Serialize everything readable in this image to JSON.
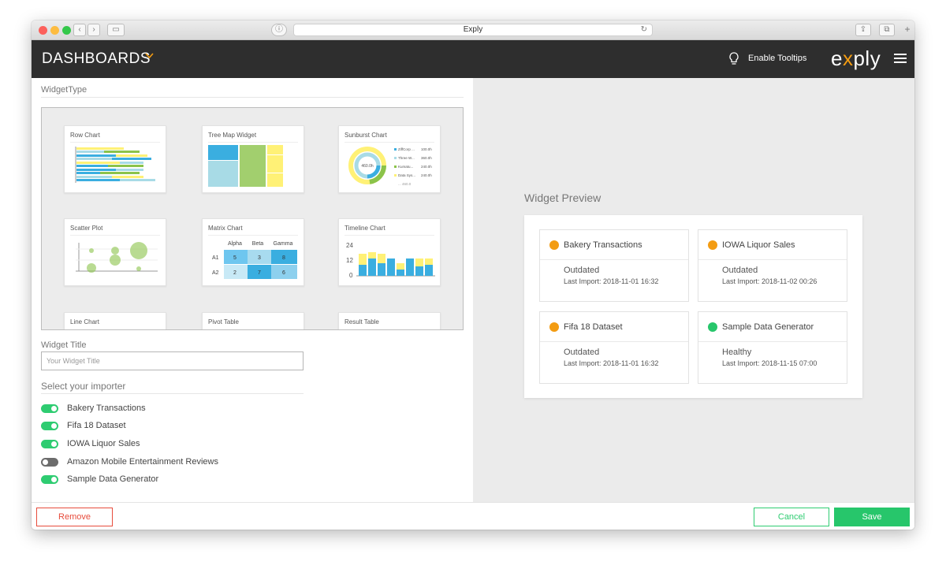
{
  "browser": {
    "url_title": "Exply",
    "info_icon": "info-circle-icon",
    "reload_icon": "reload-icon"
  },
  "appbar": {
    "title": "DASHBOARDS",
    "caret_icon": "chevron-down-icon",
    "tooltips_label": "Enable Tooltips",
    "logo_text_a": "e",
    "logo_text_x": "x",
    "logo_text_b": "ply",
    "colors": {
      "bar": "#2e2e2e",
      "accent": "#f39c12"
    }
  },
  "left": {
    "widget_type_title": "WidgetType",
    "widget_types": [
      {
        "label": "Row Chart"
      },
      {
        "label": "Tree Map Widget"
      },
      {
        "label": "Sunburst Chart"
      },
      {
        "label": "Scatter Plot"
      },
      {
        "label": "Matrix Chart"
      },
      {
        "label": "Timeline Chart"
      },
      {
        "label": "Line Chart"
      },
      {
        "label": "Pivot Table"
      },
      {
        "label": "Result Table"
      }
    ],
    "sunburst": {
      "center_value": "460.0h",
      "legend": [
        {
          "name": "ZiffCorp ...",
          "value": "100.0h",
          "color": "#3aaee0"
        },
        {
          "name": "Three W...",
          "value": "360.0h",
          "color": "#a8dbe6"
        },
        {
          "name": "Kumatu...",
          "value": "240.0h",
          "color": "#8bc34a"
        },
        {
          "name": "Data Sys...",
          "value": "240.0h",
          "color": "#fff176"
        }
      ],
      "legend_more": "... 460.0"
    },
    "matrix": {
      "columns": [
        "Alpha",
        "Beta",
        "Gamma"
      ],
      "rows": [
        {
          "label": "A1",
          "values": [
            "5",
            "3",
            "8"
          ]
        },
        {
          "label": "A2",
          "values": [
            "2",
            "7",
            "6"
          ]
        }
      ]
    },
    "timeline": {
      "ticks": [
        "24",
        "12",
        "0"
      ]
    },
    "widget_title_label": "Widget Title",
    "widget_title_placeholder": "Your Widget Title",
    "importer_title": "Select your importer",
    "importers": [
      {
        "label": "Bakery Transactions",
        "enabled": true
      },
      {
        "label": "Fifa 18 Dataset",
        "enabled": true
      },
      {
        "label": "IOWA Liquor Sales",
        "enabled": true
      },
      {
        "label": "Amazon Mobile Entertainment Reviews",
        "enabled": false
      },
      {
        "label": "Sample Data Generator",
        "enabled": true
      }
    ]
  },
  "preview": {
    "title": "Widget Preview",
    "cards": [
      {
        "name": "Bakery Transactions",
        "status": "Outdated",
        "last_import": "Last Import: 2018-11-01 16:32",
        "color": "#f39c12"
      },
      {
        "name": "IOWA Liquor Sales",
        "status": "Outdated",
        "last_import": "Last Import: 2018-11-02 00:26",
        "color": "#f39c12"
      },
      {
        "name": "Fifa 18 Dataset",
        "status": "Outdated",
        "last_import": "Last Import: 2018-11-01 16:32",
        "color": "#f39c12"
      },
      {
        "name": "Sample Data Generator",
        "status": "Healthy",
        "last_import": "Last Import: 2018-11-15 07:00",
        "color": "#27c66b"
      }
    ]
  },
  "footer": {
    "remove_label": "Remove",
    "cancel_label": "Cancel",
    "save_label": "Save"
  }
}
